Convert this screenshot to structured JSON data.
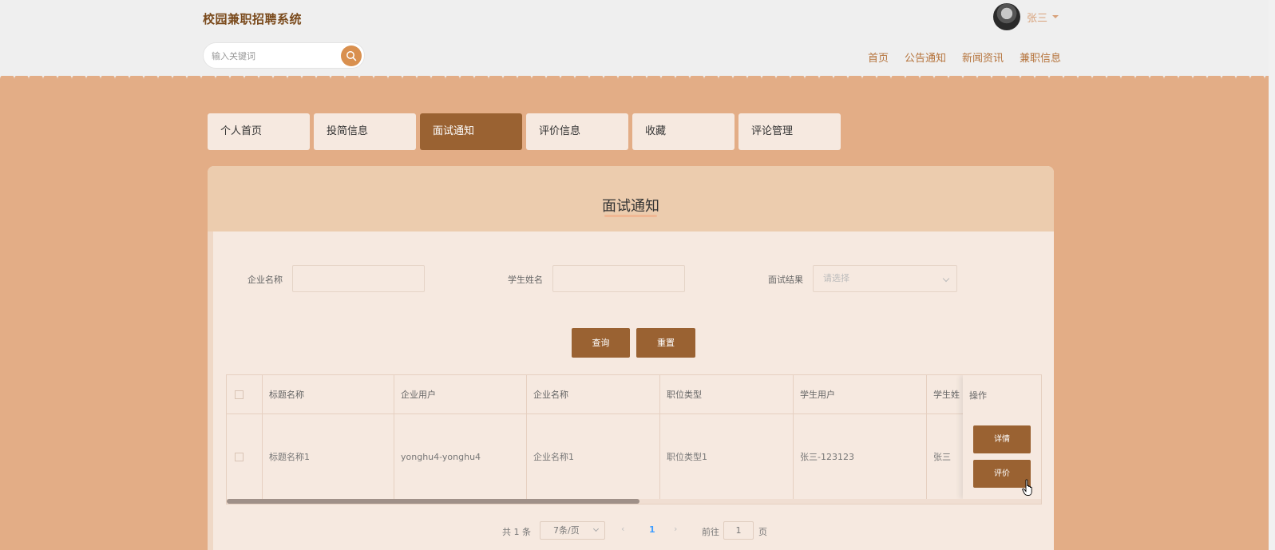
{
  "header": {
    "site_title": "校园兼职招聘系统",
    "search_placeholder": "输入关键词",
    "username": "张三",
    "nav": [
      "首页",
      "公告通知",
      "新闻资讯",
      "兼职信息"
    ]
  },
  "tabs": [
    {
      "label": "个人首页",
      "active": false
    },
    {
      "label": "投简信息",
      "active": false
    },
    {
      "label": "面试通知",
      "active": true
    },
    {
      "label": "评价信息",
      "active": false
    },
    {
      "label": "收藏",
      "active": false
    },
    {
      "label": "评论管理",
      "active": false
    }
  ],
  "panel": {
    "title": "面试通知",
    "filters": {
      "company_label": "企业名称",
      "company_value": "",
      "student_label": "学生姓名",
      "student_value": "",
      "result_label": "面试结果",
      "result_placeholder": "请选择"
    },
    "query_button": "查询",
    "reset_button": "重置"
  },
  "table": {
    "columns": [
      "标题名称",
      "企业用户",
      "企业名称",
      "职位类型",
      "学生用户",
      "学生姓"
    ],
    "ops_header": "操作",
    "rows": [
      {
        "cells": [
          "标题名称1",
          "yonghu4-yonghu4",
          "企业名称1",
          "职位类型1",
          "张三-123123",
          "张三"
        ]
      }
    ],
    "detail_button": "详情",
    "review_button": "评价"
  },
  "pager": {
    "total": "共 1 条",
    "page_size": "7条/页",
    "prev": "‹",
    "current": "1",
    "next": "›",
    "goto": "前往",
    "jump_value": "1",
    "page_unit": "页"
  },
  "colors": {
    "accent": "#9a6232",
    "background": "#e3ad86",
    "panel": "#f6e9e0",
    "panel_head": "#ecccae"
  }
}
